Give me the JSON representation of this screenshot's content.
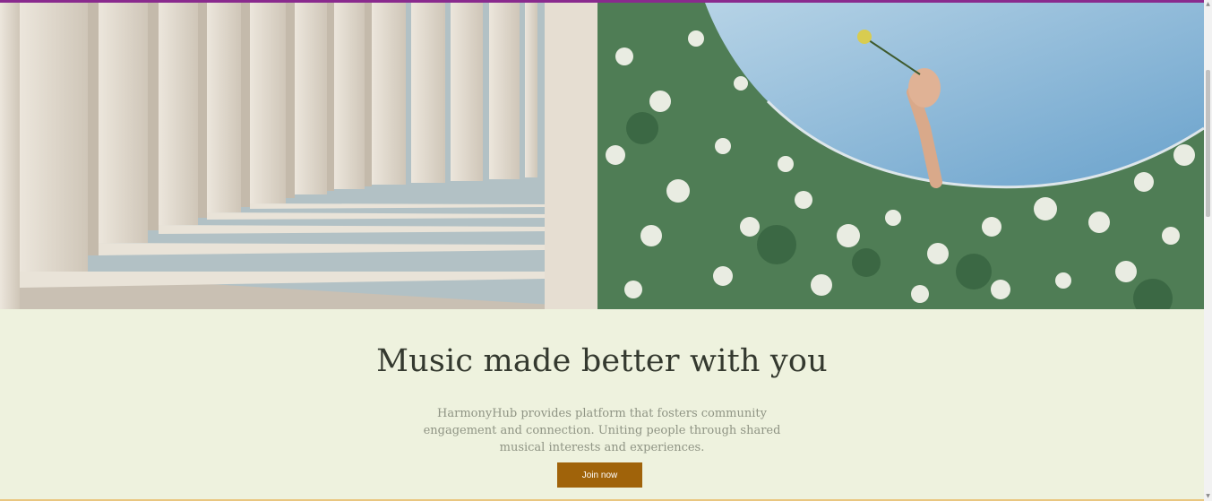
{
  "hero": {
    "left_image": "white-colonnade-photo",
    "right_image": "hand-holding-flower-over-hedge-photo"
  },
  "main": {
    "headline": "Music made better with you",
    "description": "HarmonyHub provides platform that fosters community engagement and connection. Uniting people through shared musical interests and experiences.",
    "cta_label": "Join now"
  },
  "colors": {
    "background": "#eef2de",
    "accent_top_border": "#8a2a8e",
    "button": "#a0630a",
    "bottom_border": "#e9c680"
  },
  "icons": {
    "scroll_up": "▲",
    "scroll_down": "▼"
  }
}
